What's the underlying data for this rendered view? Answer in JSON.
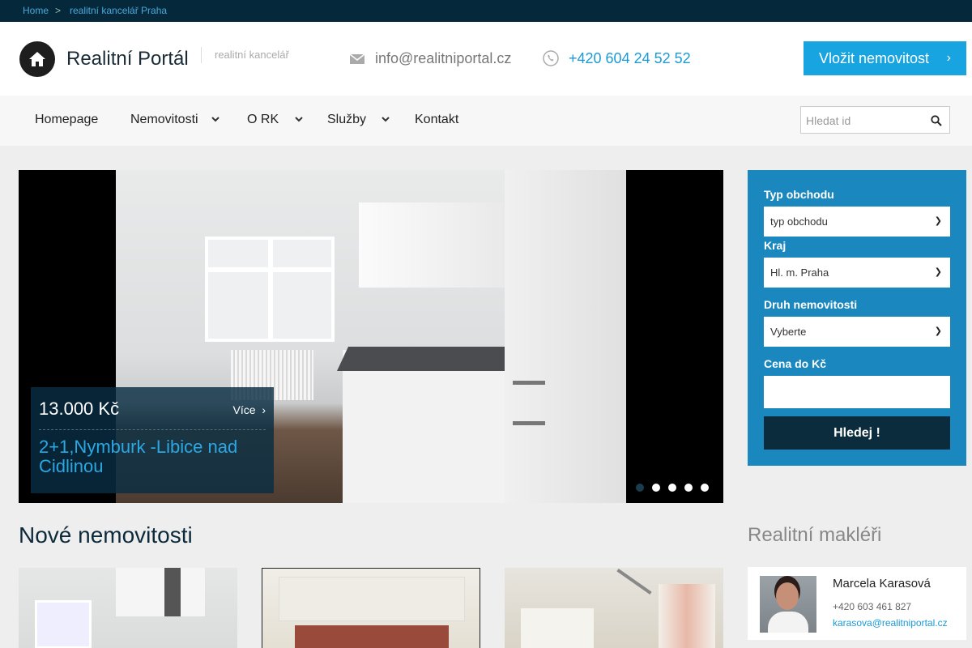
{
  "breadcrumb": {
    "home": "Home",
    "sep": ">",
    "current": "realitní kancelář Praha"
  },
  "header": {
    "brand": "Realitní Portál",
    "tagline": "realitní kancelář",
    "email": "info@realitniportal.cz",
    "phone": "+420 604 24 52 52",
    "cta_label": "Vložit nemovitost",
    "cta_color": "#18a4e0"
  },
  "nav": {
    "items": [
      {
        "label": "Homepage",
        "has_dropdown": false
      },
      {
        "label": "Nemovitosti",
        "has_dropdown": true
      },
      {
        "label": "O RK",
        "has_dropdown": true
      },
      {
        "label": "Služby",
        "has_dropdown": true
      },
      {
        "label": "Kontakt",
        "has_dropdown": false
      }
    ],
    "search_placeholder": "Hledat id"
  },
  "slider": {
    "price": "13.000 Kč",
    "more_label": "Více",
    "title": "2+1,Nymburk -Libice nad Cidlinou",
    "slides_count": 5,
    "active_slide": 1
  },
  "filter": {
    "type_label": "Typ obchodu",
    "type_value": "typ obchodu",
    "region_label": "Kraj",
    "region_value": "Hl. m. Praha",
    "kind_label": "Druh nemovitosti",
    "kind_value": "Vyberte",
    "price_label": "Cena do Kč",
    "price_value": "",
    "submit_label": "Hledej !",
    "panel_color": "#1a88bf"
  },
  "new_listings": {
    "title": "Nové nemovitosti"
  },
  "agents": {
    "title": "Realitní makléři",
    "items": [
      {
        "name": "Marcela Karasová",
        "phone": "+420 603 461 827",
        "email": "karasova@realitniportal.cz"
      }
    ]
  }
}
